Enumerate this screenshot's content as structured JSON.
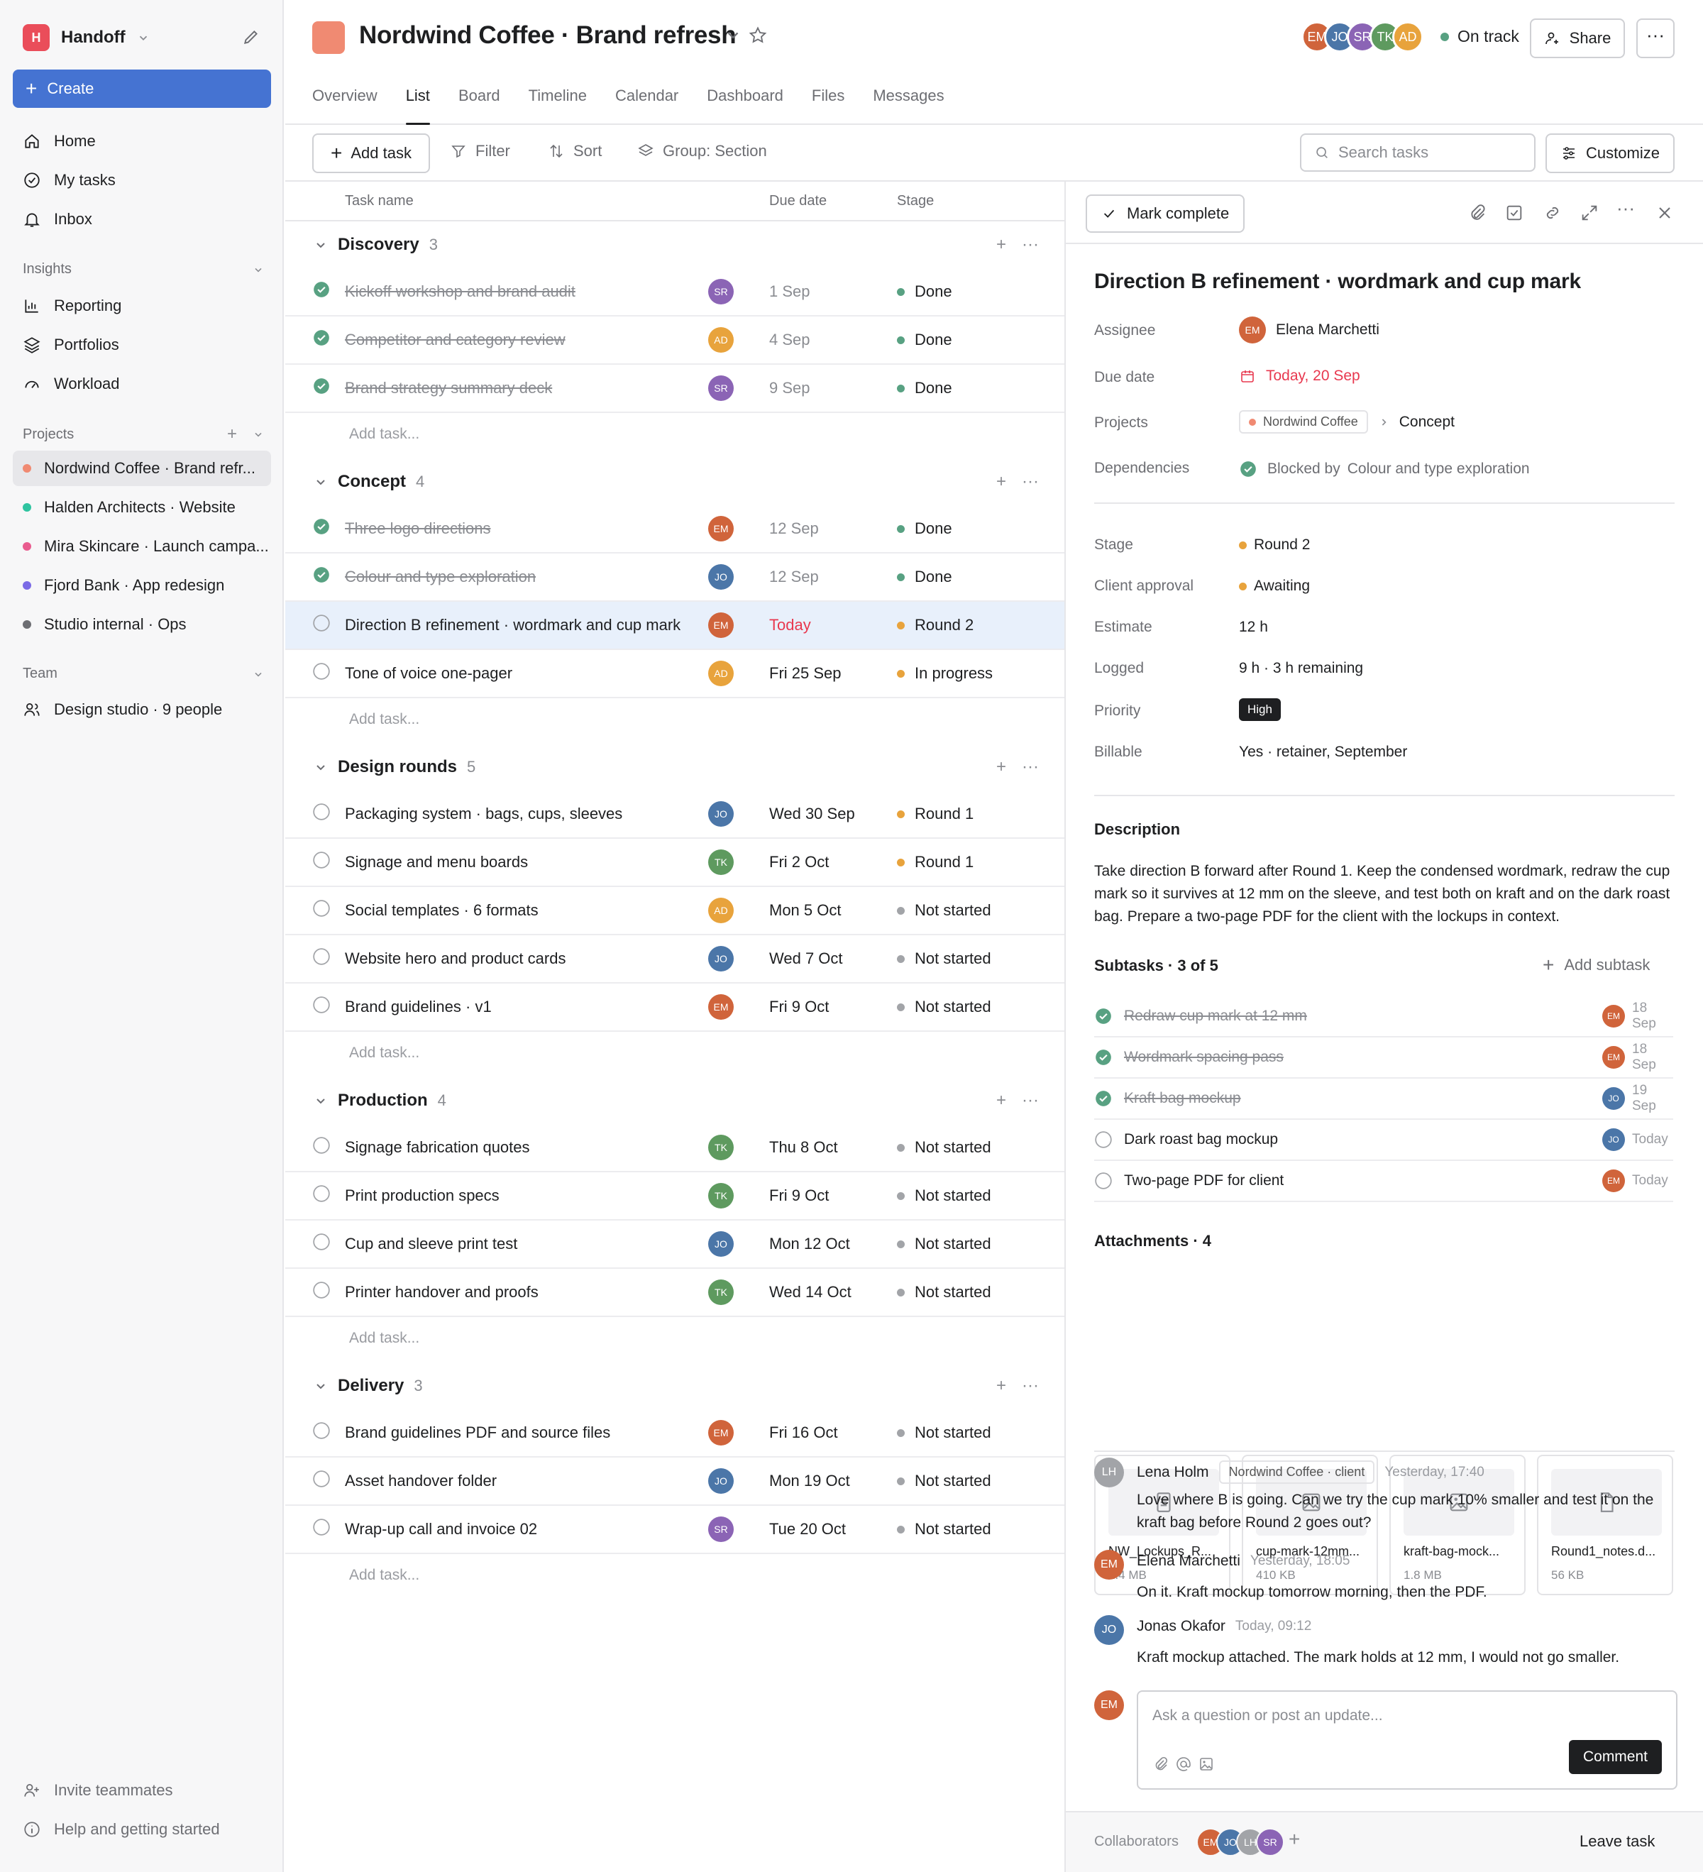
{
  "workspace": {
    "initial": "H",
    "name": "Handoff"
  },
  "create_label": "Create",
  "nav": [
    {
      "label": "Home",
      "icon": "home-icon"
    },
    {
      "label": "My tasks",
      "icon": "check-circle-icon"
    },
    {
      "label": "Inbox",
      "icon": "bell-icon"
    }
  ],
  "insights": {
    "title": "Insights",
    "items": [
      {
        "label": "Reporting",
        "icon": "chart-icon"
      },
      {
        "label": "Portfolios",
        "icon": "layers-icon"
      },
      {
        "label": "Workload",
        "icon": "gauge-icon"
      }
    ]
  },
  "projects_title": "Projects",
  "projects": [
    {
      "label": "Nordwind Coffee · Brand refr...",
      "color": "#f08a72"
    },
    {
      "label": "Halden Architects · Website",
      "color": "#2fc4a0"
    },
    {
      "label": "Mira Skincare · Launch campa...",
      "color": "#e95c8f"
    },
    {
      "label": "Fjord Bank · App redesign",
      "color": "#7b6be6"
    },
    {
      "label": "Studio internal · Ops",
      "color": "#6d6e73"
    }
  ],
  "team": {
    "title": "Team",
    "item": "Design studio · 9 people"
  },
  "footer": {
    "invite": "Invite teammates",
    "help": "Help and getting started"
  },
  "project": {
    "title": "Nordwind Coffee · Brand refresh",
    "status": "On track",
    "status_color": "#58a182"
  },
  "header_avatars": [
    {
      "i": "EM",
      "c": "#d0643b"
    },
    {
      "i": "JO",
      "c": "#4b76a8"
    },
    {
      "i": "SR",
      "c": "#8b64b5"
    },
    {
      "i": "TK",
      "c": "#5e9a5f"
    },
    {
      "i": "AD",
      "c": "#e8a33c"
    }
  ],
  "share_label": "Share",
  "tabs": [
    "Overview",
    "List",
    "Board",
    "Timeline",
    "Calendar",
    "Dashboard",
    "Files",
    "Messages"
  ],
  "toolbar": {
    "add": "Add task",
    "filter": "Filter",
    "sort": "Sort",
    "group": "Group: Section",
    "search_placeholder": "Search tasks",
    "customize": "Customize"
  },
  "columns": {
    "name": "Task name",
    "due": "Due date",
    "stage": "Stage"
  },
  "add_task_label": "Add task...",
  "sections": [
    {
      "name": "Discovery",
      "count": "3",
      "tasks": [
        {
          "name": "Kickoff workshop and brand audit",
          "done": true,
          "av": "SR",
          "due": "1 Sep",
          "stage": "Done"
        },
        {
          "name": "Competitor and category review",
          "done": true,
          "av": "AD",
          "due": "4 Sep",
          "stage": "Done"
        },
        {
          "name": "Brand strategy summary deck",
          "done": true,
          "av": "SR",
          "due": "9 Sep",
          "stage": "Done"
        }
      ]
    },
    {
      "name": "Concept",
      "count": "4",
      "tasks": [
        {
          "name": "Three logo directions",
          "done": true,
          "av": "EM",
          "due": "12 Sep",
          "stage": "Done"
        },
        {
          "name": "Colour and type exploration",
          "done": true,
          "av": "JO",
          "due": "12 Sep",
          "stage": "Done"
        },
        {
          "name": "Direction B refinement · wordmark and cup mark",
          "done": false,
          "sel": true,
          "av": "EM",
          "due": "Today",
          "today": true,
          "stage": "Round 2"
        },
        {
          "name": "Tone of voice one-pager",
          "done": false,
          "av": "AD",
          "due": "Fri 25 Sep",
          "stage": "In progress"
        }
      ]
    },
    {
      "name": "Design rounds",
      "count": "5",
      "tasks": [
        {
          "name": "Packaging system · bags, cups, sleeves",
          "done": false,
          "av": "JO",
          "due": "Wed 30 Sep",
          "stage": "Round 1"
        },
        {
          "name": "Signage and menu boards",
          "done": false,
          "av": "TK",
          "due": "Fri 2 Oct",
          "stage": "Round 1"
        },
        {
          "name": "Social templates · 6 formats",
          "done": false,
          "av": "AD",
          "due": "Mon 5 Oct",
          "stage": "Not started"
        },
        {
          "name": "Website hero and product cards",
          "done": false,
          "av": "JO",
          "due": "Wed 7 Oct",
          "stage": "Not started"
        },
        {
          "name": "Brand guidelines · v1",
          "done": false,
          "av": "EM",
          "due": "Fri 9 Oct",
          "stage": "Not started"
        }
      ]
    },
    {
      "name": "Production",
      "count": "4",
      "tasks": [
        {
          "name": "Signage fabrication quotes",
          "done": false,
          "av": "TK",
          "due": "Thu 8 Oct",
          "stage": "Not started"
        },
        {
          "name": "Print production specs",
          "done": false,
          "av": "TK",
          "due": "Fri 9 Oct",
          "stage": "Not started"
        },
        {
          "name": "Cup and sleeve print test",
          "done": false,
          "av": "JO",
          "due": "Mon 12 Oct",
          "stage": "Not started"
        },
        {
          "name": "Printer handover and proofs",
          "done": false,
          "av": "TK",
          "due": "Wed 14 Oct",
          "stage": "Not started"
        }
      ]
    },
    {
      "name": "Delivery",
      "count": "3",
      "tasks": [
        {
          "name": "Brand guidelines PDF and source files",
          "done": false,
          "av": "EM",
          "due": "Fri 16 Oct",
          "stage": "Not started"
        },
        {
          "name": "Asset handover folder",
          "done": false,
          "av": "JO",
          "due": "Mon 19 Oct",
          "stage": "Not started"
        },
        {
          "name": "Wrap-up call and invoice 02",
          "done": false,
          "av": "SR",
          "due": "Tue 20 Oct",
          "stage": "Not started"
        }
      ]
    }
  ],
  "stage_colors": {
    "Done": "#58a182",
    "Round 2": "#e8a33c",
    "Round 1": "#e8a33c",
    "In progress": "#e8a33c",
    "Not started": "#a2a4a8"
  },
  "avatar_colors": {
    "EM": "#d0643b",
    "JO": "#4b76a8",
    "SR": "#8b64b5",
    "TK": "#5e9a5f",
    "AD": "#e8a33c",
    "LH": "#a2a4a8"
  },
  "detail": {
    "mark_complete": "Mark complete",
    "title": "Direction B refinement · wordmark and cup mark",
    "labels": {
      "assignee": "Assignee",
      "due": "Due date",
      "projects": "Projects",
      "deps": "Dependencies",
      "stage": "Stage",
      "approval": "Client approval",
      "estimate": "Estimate",
      "logged": "Logged",
      "priority": "Priority",
      "billable": "Billable"
    },
    "assignee": "Elena Marchetti",
    "due": "Today, 20 Sep",
    "project_pill": "Nordwind Coffee",
    "project_section": "Concept",
    "blocked_by": "Blocked by",
    "blocked_task": "Colour and type exploration",
    "stage": "Round 2",
    "approval": "Awaiting",
    "estimate": "12 h",
    "logged": "9 h · 3 h remaining",
    "priority": "High",
    "billable": "Yes · retainer, September",
    "desc_title": "Description",
    "description": "Take direction B forward after Round 1. Keep the condensed wordmark, redraw the cup mark so it survives at 12 mm on the sleeve, and test both on kraft and on the dark roast bag. Prepare a two-page PDF for the client with the lockups in context.",
    "subtasks_title": "Subtasks · 3 of 5",
    "add_subtask": "Add subtask",
    "subtasks": [
      {
        "name": "Redraw cup mark at 12 mm",
        "done": true,
        "av": "EM",
        "d": "18 Sep"
      },
      {
        "name": "Wordmark spacing pass",
        "done": true,
        "av": "EM",
        "d": "18 Sep"
      },
      {
        "name": "Kraft bag mockup",
        "done": true,
        "av": "JO",
        "d": "19 Sep"
      },
      {
        "name": "Dark roast bag mockup",
        "done": false,
        "av": "JO",
        "d": "Today"
      },
      {
        "name": "Two-page PDF for client",
        "done": false,
        "av": "EM",
        "d": "Today"
      }
    ],
    "attachments_title": "Attachments · 4",
    "attachments": [
      {
        "name": "NW_Lockups_R...",
        "size": "2.4 MB",
        "icon": "document-icon"
      },
      {
        "name": "cup-mark-12mm...",
        "size": "410 KB",
        "icon": "image-icon"
      },
      {
        "name": "kraft-bag-mock...",
        "size": "1.8 MB",
        "icon": "image-icon"
      },
      {
        "name": "Round1_notes.d...",
        "size": "56 KB",
        "icon": "file-icon"
      }
    ],
    "comments": [
      {
        "av": "LH",
        "who": "Lena Holm",
        "tag": "Nordwind Coffee · client",
        "time": "Yesterday, 17:40",
        "text": "Love where B is going. Can we try the cup mark 10% smaller and test it on the kraft bag before Round 2 goes out?"
      },
      {
        "av": "EM",
        "who": "Elena Marchetti",
        "time": "Yesterday, 18:05",
        "text": "On it. Kraft mockup tomorrow morning, then the PDF."
      },
      {
        "av": "JO",
        "who": "Jonas Okafor",
        "time": "Today, 09:12",
        "text": "Kraft mockup attached. The mark holds at 12 mm, I would not go smaller."
      }
    ],
    "compose_placeholder": "Ask a question or post an update...",
    "comment_button": "Comment",
    "collaborators_label": "Collaborators",
    "collaborators": [
      "EM",
      "JO",
      "LH",
      "SR"
    ],
    "leave": "Leave task"
  }
}
